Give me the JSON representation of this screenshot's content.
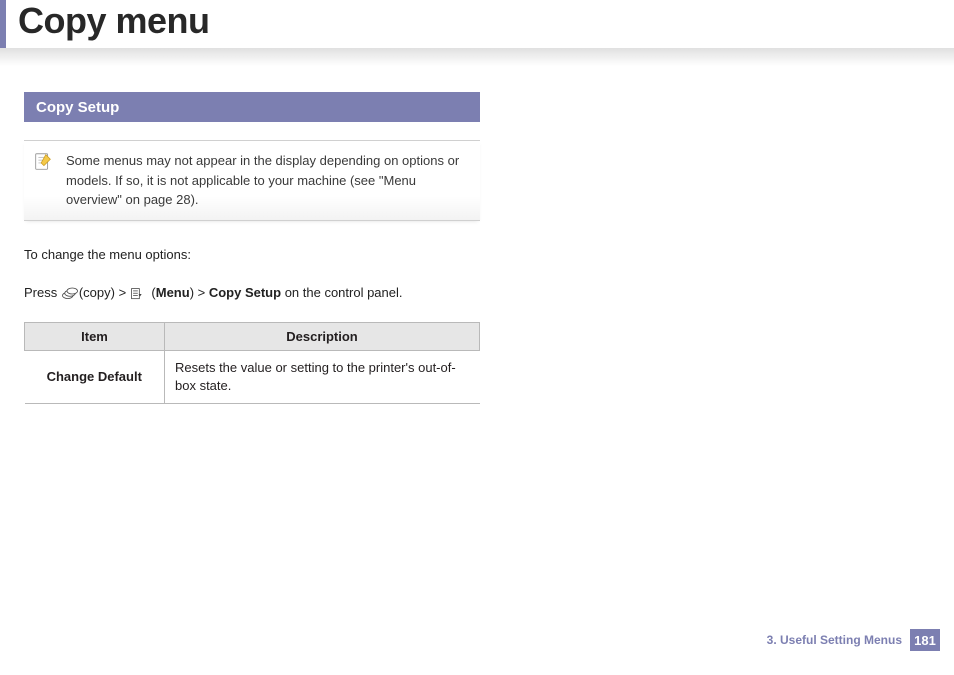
{
  "header": {
    "title": "Copy menu"
  },
  "section": {
    "title": "Copy Setup",
    "note": "Some menus may not appear in the display depending on options or models. If so, it is not applicable to your machine (see \"Menu overview\" on page 28).",
    "intro": "To change the menu options:",
    "press_a": "Press ",
    "press_copy": "(copy) > ",
    "press_menu_open": " (",
    "press_menu": "Menu",
    "press_menu_close": ") > ",
    "press_setup": "Copy Setup",
    "press_tail": " on the control panel."
  },
  "table": {
    "headers": [
      "Item",
      "Description"
    ],
    "rows": [
      {
        "item": "Change Default",
        "desc": "Resets the value or setting to the printer's out-of-box state."
      }
    ]
  },
  "footer": {
    "chapter": "3.  Useful Setting Menus",
    "page": "181"
  }
}
